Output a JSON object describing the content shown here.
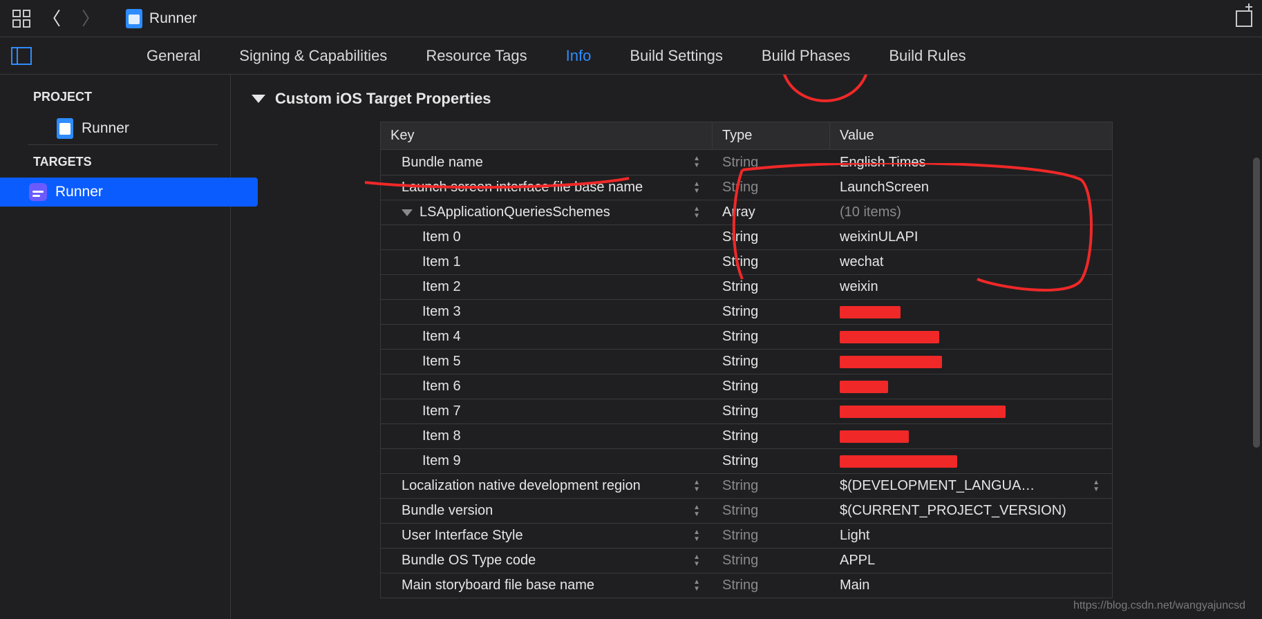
{
  "topbar": {
    "breadcrumb": "Runner"
  },
  "tabs": {
    "general": "General",
    "signing": "Signing & Capabilities",
    "resource": "Resource Tags",
    "info": "Info",
    "build_settings": "Build Settings",
    "build_phases": "Build Phases",
    "build_rules": "Build Rules",
    "active": "info"
  },
  "sidebar": {
    "project_header": "PROJECT",
    "project_items": [
      "Runner"
    ],
    "targets_header": "TARGETS",
    "targets_items": [
      "Runner"
    ],
    "selected_target": "Runner"
  },
  "section_title": "Custom iOS Target Properties",
  "plist": {
    "columns": {
      "key": "Key",
      "type": "Type",
      "value": "Value"
    },
    "rows": [
      {
        "key": "Bundle name",
        "type": "String",
        "type_dim": true,
        "value": "English Times",
        "stepper": true
      },
      {
        "key": "Launch screen interface file base name",
        "type": "String",
        "type_dim": true,
        "value": "LaunchScreen",
        "stepper": true
      },
      {
        "key": "LSApplicationQueriesSchemes",
        "type": "Array",
        "type_dim": false,
        "value": "(10 items)",
        "value_dim": true,
        "stepper": true,
        "expandable": true,
        "expanded": true
      },
      {
        "key": "Item 0",
        "type": "String",
        "value": "weixinULAPI",
        "child": true
      },
      {
        "key": "Item 1",
        "type": "String",
        "value": "wechat",
        "child": true
      },
      {
        "key": "Item 2",
        "type": "String",
        "value": "weixin",
        "child": true
      },
      {
        "key": "Item 3",
        "type": "String",
        "value": "",
        "child": true,
        "redact": 88
      },
      {
        "key": "Item 4",
        "type": "String",
        "value": "",
        "child": true,
        "redact": 144
      },
      {
        "key": "Item 5",
        "type": "String",
        "value": "",
        "child": true,
        "redact": 148
      },
      {
        "key": "Item 6",
        "type": "String",
        "value": "",
        "child": true,
        "redact": 70
      },
      {
        "key": "Item 7",
        "type": "String",
        "value": "",
        "child": true,
        "redact": 240
      },
      {
        "key": "Item 8",
        "type": "String",
        "value": "",
        "child": true,
        "redact": 100
      },
      {
        "key": "Item 9",
        "type": "String",
        "value": "",
        "child": true,
        "redact": 170
      },
      {
        "key": "Localization native development region",
        "type": "String",
        "type_dim": true,
        "value": "$(DEVELOPMENT_LANGUA…",
        "stepper": true,
        "trailing_stepper": true
      },
      {
        "key": "Bundle version",
        "type": "String",
        "type_dim": true,
        "value": "$(CURRENT_PROJECT_VERSION)",
        "stepper": true
      },
      {
        "key": "User Interface Style",
        "type": "String",
        "type_dim": true,
        "value": "Light",
        "stepper": true
      },
      {
        "key": "Bundle OS Type code",
        "type": "String",
        "type_dim": true,
        "value": "APPL",
        "stepper": true
      },
      {
        "key": "Main storyboard file base name",
        "type": "String",
        "type_dim": true,
        "value": "Main",
        "stepper": true
      }
    ]
  },
  "watermark": "https://blog.csdn.net/wangyajuncsd"
}
